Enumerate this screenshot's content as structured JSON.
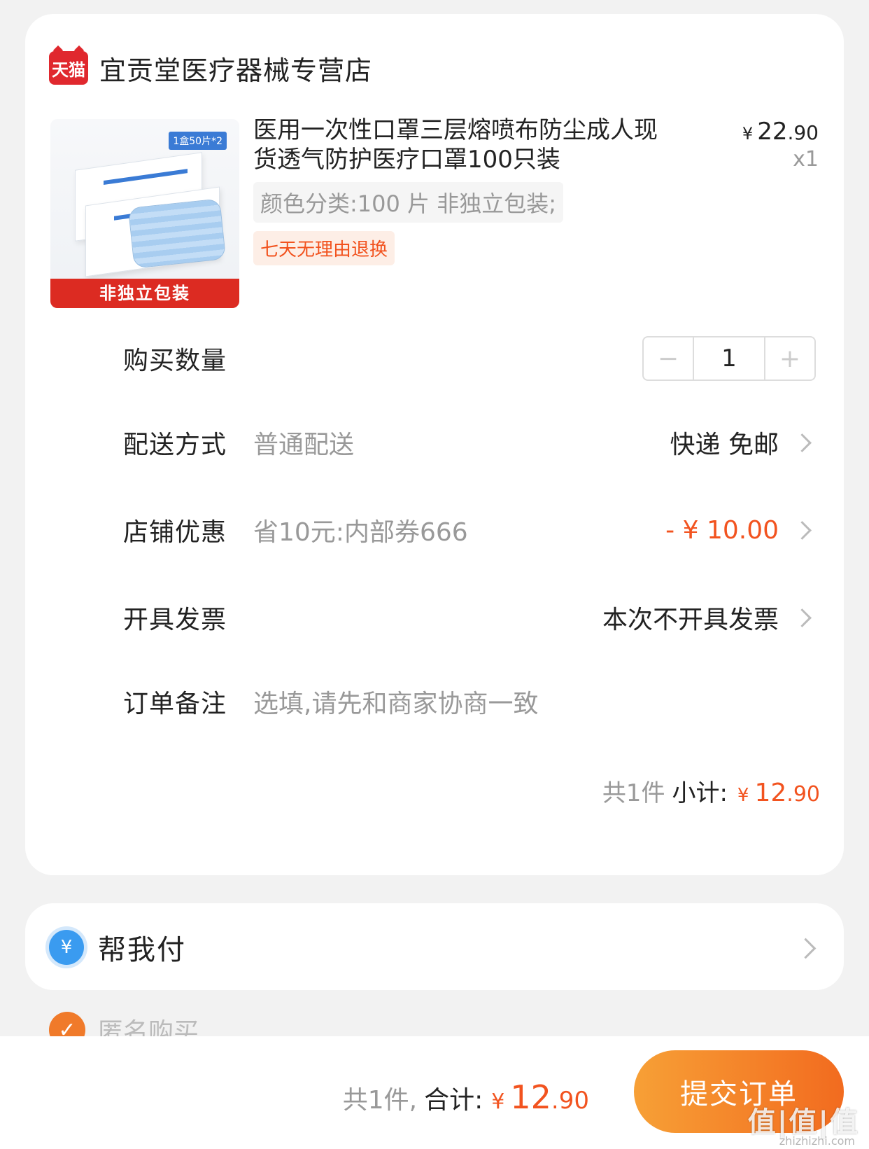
{
  "shop": {
    "logo_text": "天猫",
    "name": "宜贡堂医疗器械专营店"
  },
  "product": {
    "image_badge": "1盒50片*2",
    "image_ribbon": "非独立包装",
    "title": "医用一次性口罩三层熔喷布防尘成人现货透气防护医疗口罩100只装",
    "price_symbol": "¥",
    "price_int": "22",
    "price_dec": ".90",
    "quantity": "x1",
    "sku": "颜色分类:100 片 非独立包装;",
    "return_policy": "七天无理由退换"
  },
  "rows": {
    "quantity": {
      "label": "购买数量",
      "minus": "−",
      "value": "1",
      "plus": "+"
    },
    "shipping": {
      "label": "配送方式",
      "value": "普通配送",
      "right": "快递 免邮"
    },
    "discount": {
      "label": "店铺优惠",
      "value": "省10元:内部券666",
      "right": "- ¥ 10.00"
    },
    "invoice": {
      "label": "开具发票",
      "right": "本次不开具发票"
    },
    "note": {
      "label": "订单备注",
      "placeholder": "选填,请先和商家协商一致"
    }
  },
  "subtotal": {
    "count": "共1件",
    "label": "小计:",
    "symbol": "¥",
    "int": "12",
    "dec": ".90"
  },
  "pay_for_me": {
    "icon": "¥",
    "label": "帮我付"
  },
  "anonymous": {
    "icon": "✓",
    "label": "匿名购买"
  },
  "bottom": {
    "count": "共1件,",
    "label": "合计:",
    "symbol": "¥",
    "int": "12",
    "dec": ".90",
    "submit": "提交订单"
  },
  "watermark": {
    "main": "值|值|值",
    "sub": "zhizhizhi.com"
  },
  "colors": {
    "accent": "#f2531f",
    "tmall_red": "#e0282e",
    "pay_blue": "#3a9bf0"
  }
}
